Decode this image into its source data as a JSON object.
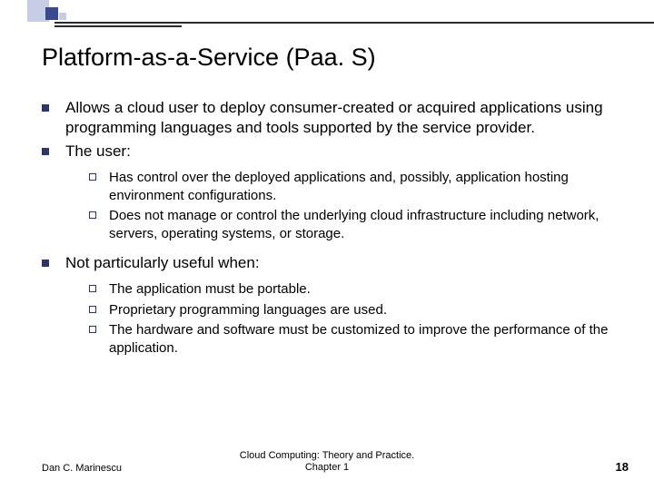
{
  "title": "Platform-as-a-Service (Paa. S)",
  "bullets": [
    {
      "text": "Allows a cloud user  to deploy consumer-created or acquired applications using programming languages and tools supported by the service provider."
    },
    {
      "text": "The user:",
      "subs": [
        "Has control over the deployed applications and, possibly, application hosting environment configurations.",
        "Does not manage or control the underlying cloud infrastructure including network, servers, operating systems, or storage."
      ]
    },
    {
      "text": "Not particularly useful when:",
      "subs": [
        "The application must be portable.",
        "Proprietary programming languages are used.",
        "The hardware and software must be customized to improve the performance of the application."
      ]
    }
  ],
  "footer": {
    "author": "Dan C. Marinescu",
    "center_line1": "Cloud Computing: Theory and Practice.",
    "center_line2": "Chapter 1",
    "page": "18"
  }
}
